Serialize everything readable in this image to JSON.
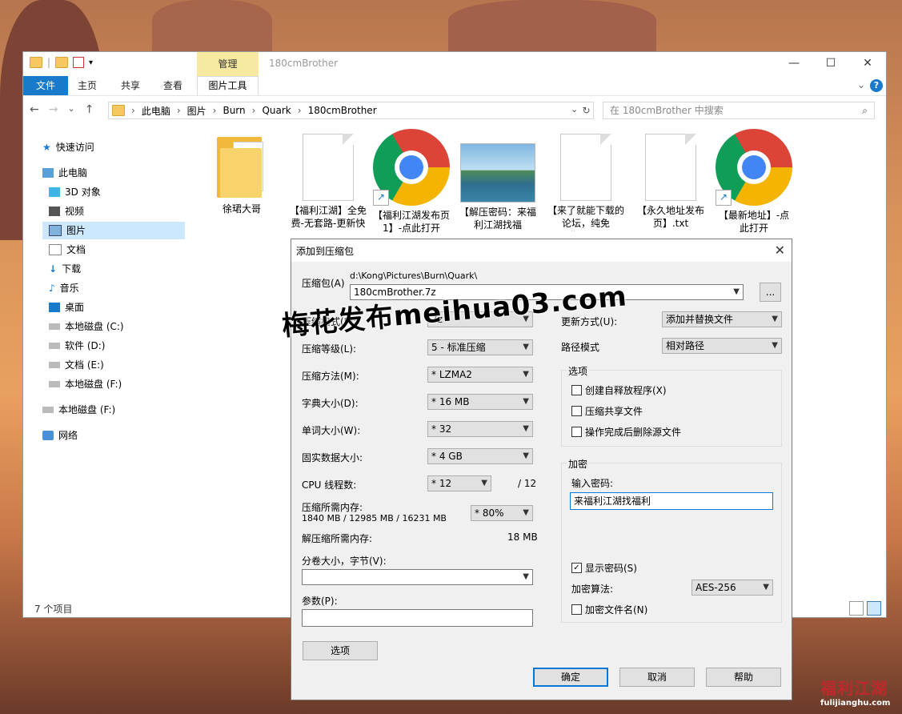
{
  "explorer": {
    "title": "180cmBrother",
    "manage_tab": "管理",
    "ribbon": {
      "file": "文件",
      "home": "主页",
      "share": "共享",
      "view": "查看",
      "picture_tools": "图片工具"
    },
    "window_buttons": {
      "minimize": "—",
      "maximize": "☐",
      "close": "✕"
    },
    "nav": {
      "back": "←",
      "forward": "→",
      "recent": "⌄",
      "up": "↑"
    },
    "breadcrumb": [
      "此电脑",
      "图片",
      "Burn",
      "Quark",
      "180cmBrother"
    ],
    "search_placeholder": "在 180cmBrother 中搜索",
    "sidebar": [
      {
        "label": "快速访问",
        "icon": "star-icon"
      },
      {
        "label": "此电脑",
        "icon": "computer-icon"
      },
      {
        "label": "3D 对象",
        "icon": "cube-icon"
      },
      {
        "label": "视频",
        "icon": "video-icon"
      },
      {
        "label": "图片",
        "icon": "picture-icon"
      },
      {
        "label": "文档",
        "icon": "document-icon"
      },
      {
        "label": "下载",
        "icon": "download-icon"
      },
      {
        "label": "音乐",
        "icon": "music-icon"
      },
      {
        "label": "桌面",
        "icon": "desktop-icon"
      },
      {
        "label": "本地磁盘 (C:)",
        "icon": "drive-icon"
      },
      {
        "label": "软件 (D:)",
        "icon": "drive-icon"
      },
      {
        "label": "文档 (E:)",
        "icon": "drive-icon"
      },
      {
        "label": "本地磁盘 (F:)",
        "icon": "drive-icon"
      },
      {
        "label": "本地磁盘 (F:)",
        "icon": "drive-icon"
      },
      {
        "label": "网络",
        "icon": "network-icon"
      }
    ],
    "files": [
      {
        "name": "徐珺大哥",
        "type": "folder"
      },
      {
        "name": "【福利江湖】全免费-无套路-更新快",
        "type": "text"
      },
      {
        "name": "【福利江湖发布页1】-点此打开",
        "type": "chrome"
      },
      {
        "name": "【解压密码：来福利江湖找福利】.jpg",
        "type": "image"
      },
      {
        "name": "【来了就能下载的论坛，纯免费】.txt",
        "type": "text"
      },
      {
        "name": "【永久地址发布页】.txt",
        "type": "text"
      },
      {
        "name": "【最新地址】-点此打开",
        "type": "chrome"
      }
    ],
    "status": "7 个项目"
  },
  "dialog": {
    "title": "添加到压缩包",
    "archive_label": "压缩包(A)",
    "archive_path": "d:\\Kong\\Pictures\\Burn\\Quark\\",
    "archive_name": "180cmBrother.7z",
    "browse": "...",
    "format_label": "压缩格式(F):",
    "format_value": "7z",
    "level_label": "压缩等级(L):",
    "level_value": "5 - 标准压缩",
    "method_label": "压缩方法(M):",
    "method_value": "* LZMA2",
    "dict_label": "字典大小(D):",
    "dict_value": "* 16 MB",
    "word_label": "单词大小(W):",
    "word_value": "* 32",
    "solid_label": "固实数据大小:",
    "solid_value": "* 4 GB",
    "cpu_label": "CPU 线程数:",
    "cpu_value": "* 12",
    "cpu_total": "/ 12",
    "mem_label": "压缩所需内存:",
    "mem_value": "1840 MB / 12985 MB / 16231 MB",
    "mem_percent": "* 80%",
    "decomp_label": "解压缩所需内存:",
    "decomp_value": "18 MB",
    "split_label": "分卷大小，字节(V):",
    "params_label": "参数(P):",
    "update_label": "更新方式(U):",
    "update_value": "添加并替换文件",
    "path_label": "路径模式",
    "path_value": "相对路径",
    "options_group": "选项",
    "opt_sfx": "创建自释放程序(X)",
    "opt_shared": "压缩共享文件",
    "opt_delete": "操作完成后删除源文件",
    "encrypt_group": "加密",
    "password_label": "输入密码:",
    "password_value": "来福利江湖找福利",
    "show_password": "显示密码(S)",
    "algo_label": "加密算法:",
    "algo_value": "AES-256",
    "encrypt_names": "加密文件名(N)",
    "btn_options": "选项",
    "btn_ok": "确定",
    "btn_cancel": "取消",
    "btn_help": "帮助"
  },
  "watermark": "梅花发布meihua03.com",
  "corner_logo": {
    "title": "福利江湖",
    "url": "fulijianghu.com"
  }
}
